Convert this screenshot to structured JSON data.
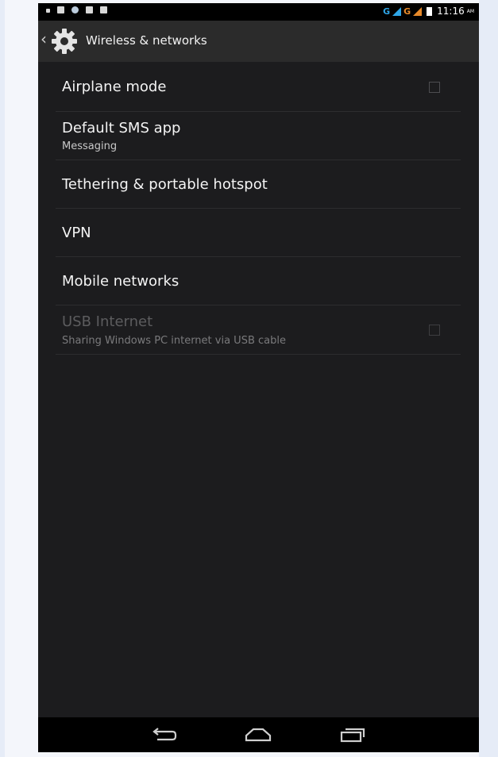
{
  "status_bar": {
    "net1": "G",
    "net2": "G",
    "time": "11:16",
    "ampm": "AM"
  },
  "action_bar": {
    "title": "Wireless & networks"
  },
  "settings": [
    {
      "title": "Airplane mode",
      "has_checkbox": true,
      "checked": false,
      "enabled": true
    },
    {
      "title": "Default SMS app",
      "subtitle": "Messaging",
      "enabled": true
    },
    {
      "title": "Tethering & portable hotspot",
      "enabled": true
    },
    {
      "title": "VPN",
      "enabled": true
    },
    {
      "title": "Mobile networks",
      "enabled": true
    },
    {
      "title": "USB Internet",
      "subtitle": "Sharing Windows PC internet via USB cable",
      "has_checkbox": true,
      "checked": false,
      "enabled": false
    }
  ],
  "nav_bar": {
    "buttons": [
      "back-icon",
      "home-icon",
      "recent-apps-icon"
    ]
  },
  "colors": {
    "background": "#1c1c1e",
    "action_bar": "#2b2b2b",
    "divider": "#2d2d2f",
    "signal_blue": "#2fa6e8",
    "signal_orange": "#e88a2a"
  }
}
